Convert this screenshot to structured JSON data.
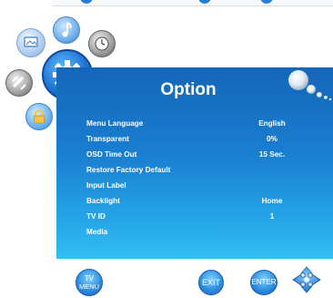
{
  "header": {
    "title": "Option"
  },
  "menu": {
    "items": [
      {
        "label": "Menu Language",
        "value": "English"
      },
      {
        "label": "Transparent",
        "value": "0%"
      },
      {
        "label": "OSD Time Out",
        "value": "15 Sec."
      },
      {
        "label": "Restore Factory Default",
        "value": ""
      },
      {
        "label": "Input Label",
        "value": ""
      },
      {
        "label": "Backlight",
        "value": "Home"
      },
      {
        "label": "TV ID",
        "value": "1"
      },
      {
        "label": "Media",
        "value": ""
      }
    ]
  },
  "footer": {
    "tv_menu_line1": "TV",
    "tv_menu_line2": "MENU",
    "exit_label": "EXIT",
    "enter_label": "ENTER"
  },
  "icons": [
    "picture-icon",
    "music-note-icon",
    "clock-icon",
    "satellite-icon",
    "gear-icon",
    "lock-icon",
    "dpad-icon"
  ],
  "colors": {
    "panel_top": "#1466b8",
    "panel_bottom": "#33bff2",
    "button_blue": "#2f8fe0",
    "selected_icon": "#1a6fd0"
  }
}
